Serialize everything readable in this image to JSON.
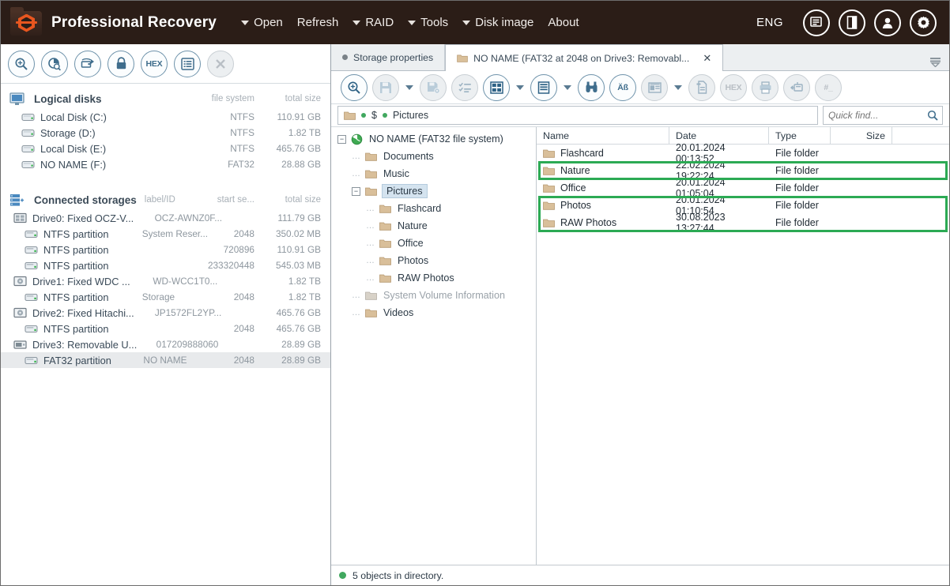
{
  "titlebar": {
    "app_title": "Professional Recovery",
    "logo_icon": "folder-hex-logo-icon",
    "menu": [
      {
        "label": "Open",
        "has_caret": true,
        "name": "menu-open"
      },
      {
        "label": "Refresh",
        "has_caret": false,
        "name": "menu-refresh"
      },
      {
        "label": "RAID",
        "has_caret": true,
        "name": "menu-raid"
      },
      {
        "label": "Tools",
        "has_caret": true,
        "name": "menu-tools"
      },
      {
        "label": "Disk image",
        "has_caret": true,
        "name": "menu-disk-image"
      },
      {
        "label": "About",
        "has_caret": false,
        "name": "menu-about"
      }
    ],
    "language": "ENG",
    "buttons": [
      {
        "name": "messages-button",
        "icon": "window-list-icon"
      },
      {
        "name": "panel-toggle-button",
        "icon": "split-panel-icon"
      },
      {
        "name": "account-button",
        "icon": "user-icon"
      },
      {
        "name": "settings-button",
        "icon": "gear-icon"
      }
    ]
  },
  "left_pane": {
    "toolbar": [
      {
        "name": "open-storage-button",
        "icon": "magnifier-disk-icon",
        "disabled": false
      },
      {
        "name": "disk-scan-button",
        "icon": "pie-scan-icon",
        "disabled": false
      },
      {
        "name": "mount-button",
        "icon": "mount-drive-icon",
        "disabled": false
      },
      {
        "name": "unlock-button",
        "icon": "lock-icon",
        "disabled": false
      },
      {
        "name": "hex-view-button",
        "icon": "hex-icon",
        "label": "HEX",
        "disabled": false
      },
      {
        "name": "properties-button",
        "icon": "list-icon",
        "disabled": false
      },
      {
        "name": "close-storage-button",
        "icon": "close-icon",
        "disabled": true
      }
    ],
    "logical_disks": {
      "title": "Logical disks",
      "icon": "monitor-icon",
      "columns": [
        "file system",
        "total size"
      ],
      "rows": [
        {
          "name": "Local Disk (C:)",
          "fs": "NTFS",
          "size": "110.91 GB",
          "icon": "drive-icon"
        },
        {
          "name": "Storage (D:)",
          "fs": "NTFS",
          "size": "1.82 TB",
          "icon": "drive-icon"
        },
        {
          "name": "Local Disk (E:)",
          "fs": "NTFS",
          "size": "465.76 GB",
          "icon": "drive-icon"
        },
        {
          "name": "NO NAME (F:)",
          "fs": "FAT32",
          "size": "28.88 GB",
          "icon": "drive-icon"
        }
      ]
    },
    "connected_storages": {
      "title": "Connected storages",
      "icon": "storages-icon",
      "columns": [
        "label/ID",
        "start se...",
        "total size"
      ],
      "rows": [
        {
          "name": "Drive0: Fixed OCZ-V...",
          "label": "OCZ-AWNZ0F...",
          "start": "",
          "size": "111.79 GB",
          "level": 0,
          "icon": "ssd-icon",
          "selected": false
        },
        {
          "name": "NTFS partition",
          "label": "System Reser...",
          "start": "2048",
          "size": "350.02 MB",
          "level": 1,
          "icon": "partition-icon",
          "selected": false
        },
        {
          "name": "NTFS partition",
          "label": "",
          "start": "720896",
          "size": "110.91 GB",
          "level": 1,
          "icon": "partition-icon",
          "selected": false
        },
        {
          "name": "NTFS partition",
          "label": "",
          "start": "233320448",
          "size": "545.03 MB",
          "level": 1,
          "icon": "partition-icon",
          "selected": false
        },
        {
          "name": "Drive1: Fixed WDC ...",
          "label": "WD-WCC1T0...",
          "start": "",
          "size": "1.82 TB",
          "level": 0,
          "icon": "hdd-icon",
          "selected": false
        },
        {
          "name": "NTFS partition",
          "label": "Storage",
          "start": "2048",
          "size": "1.82 TB",
          "level": 1,
          "icon": "partition-icon",
          "selected": false
        },
        {
          "name": "Drive2: Fixed Hitachi...",
          "label": "JP1572FL2YP...",
          "start": "",
          "size": "465.76 GB",
          "level": 0,
          "icon": "hdd-icon",
          "selected": false
        },
        {
          "name": "NTFS partition",
          "label": "",
          "start": "2048",
          "size": "465.76 GB",
          "level": 1,
          "icon": "partition-icon",
          "selected": false
        },
        {
          "name": "Drive3: Removable U...",
          "label": "017209888060",
          "start": "",
          "size": "28.89 GB",
          "level": 0,
          "icon": "usb-icon",
          "selected": false
        },
        {
          "name": "FAT32 partition",
          "label": "NO NAME",
          "start": "2048",
          "size": "28.89 GB",
          "level": 1,
          "icon": "partition-icon",
          "selected": true
        }
      ]
    }
  },
  "right_pane": {
    "tabs": [
      {
        "label": "Storage properties",
        "active": false,
        "icon": "dot-icon",
        "closable": false,
        "name": "tab-storage-properties"
      },
      {
        "label": "NO NAME (FAT32 at 2048 on Drive3: Removabl...",
        "active": true,
        "icon": "folder-icon",
        "closable": true,
        "close_glyph": "✕",
        "name": "tab-no-name-fat32"
      }
    ],
    "tabstrip_menu_icon": "tab-list-dropdown-icon",
    "toolbar": [
      {
        "name": "search-button",
        "icon": "magnifier-disk-icon",
        "dropdown": false,
        "disabled": false
      },
      {
        "name": "save-button",
        "icon": "save-icon",
        "dropdown": true,
        "disabled": true
      },
      {
        "name": "save-options-button",
        "icon": "save-settings-icon",
        "dropdown": false,
        "disabled": true
      },
      {
        "name": "checklist-button",
        "icon": "checklist-icon",
        "dropdown": false,
        "disabled": true
      },
      {
        "name": "layout-button",
        "icon": "grid-layout-icon",
        "dropdown": true,
        "disabled": false
      },
      {
        "name": "view-mode-button",
        "icon": "list-view-icon",
        "dropdown": true,
        "disabled": false
      },
      {
        "name": "find-button",
        "icon": "binoculars-icon",
        "dropdown": false,
        "disabled": false
      },
      {
        "name": "encoding-button",
        "icon": "text-encoding-icon",
        "label": "Äß",
        "dropdown": false,
        "disabled": false
      },
      {
        "name": "preview-button",
        "icon": "preview-pane-icon",
        "dropdown": true,
        "disabled": true
      },
      {
        "name": "copy-file-button",
        "icon": "copy-file-icon",
        "dropdown": false,
        "disabled": true
      },
      {
        "name": "hex-view-button",
        "icon": "hex-icon",
        "label": "HEX",
        "dropdown": false,
        "disabled": true
      },
      {
        "name": "print-button",
        "icon": "print-icon",
        "dropdown": false,
        "disabled": true
      },
      {
        "name": "export-button",
        "icon": "export-icon",
        "dropdown": false,
        "disabled": true
      },
      {
        "name": "goto-offset-button",
        "icon": "hash-icon",
        "label": "#_",
        "dropdown": false,
        "disabled": true
      }
    ],
    "path": {
      "icon": "folder-icon",
      "segments": [
        "$",
        "Pictures"
      ]
    },
    "quick_find": {
      "placeholder": "Quick find...",
      "value": "",
      "icon": "search-icon"
    },
    "tree": [
      {
        "label": "NO NAME (FAT32 file system)",
        "level": 0,
        "toggle": "minus",
        "icon": "volume-icon",
        "selected": false,
        "dim": false
      },
      {
        "label": "Documents",
        "level": 1,
        "toggle": "none",
        "icon": "folder-icon",
        "selected": false,
        "dim": false
      },
      {
        "label": "Music",
        "level": 1,
        "toggle": "none",
        "icon": "folder-icon",
        "selected": false,
        "dim": false
      },
      {
        "label": "Pictures",
        "level": 1,
        "toggle": "minus",
        "icon": "folder-icon",
        "selected": true,
        "dim": false
      },
      {
        "label": "Flashcard",
        "level": 2,
        "toggle": "none",
        "icon": "folder-icon",
        "selected": false,
        "dim": false
      },
      {
        "label": "Nature",
        "level": 2,
        "toggle": "none",
        "icon": "folder-icon",
        "selected": false,
        "dim": false
      },
      {
        "label": "Office",
        "level": 2,
        "toggle": "none",
        "icon": "folder-icon",
        "selected": false,
        "dim": false
      },
      {
        "label": "Photos",
        "level": 2,
        "toggle": "none",
        "icon": "folder-icon",
        "selected": false,
        "dim": false
      },
      {
        "label": "RAW Photos",
        "level": 2,
        "toggle": "none",
        "icon": "folder-icon",
        "selected": false,
        "dim": false
      },
      {
        "label": "System Volume Information",
        "level": 1,
        "toggle": "none",
        "icon": "folder-icon",
        "selected": false,
        "dim": true
      },
      {
        "label": "Videos",
        "level": 1,
        "toggle": "none",
        "icon": "folder-icon",
        "selected": false,
        "dim": false
      }
    ],
    "file_list": {
      "columns": [
        "Name",
        "Date",
        "Type",
        "Size"
      ],
      "rows": [
        {
          "name": "Flashcard",
          "date": "20.01.2024 00:13:52",
          "type": "File folder",
          "size": "",
          "icon": "folder-icon",
          "highlighted": false
        },
        {
          "name": "Nature",
          "date": "22.02.2024 19:22:24",
          "type": "File folder",
          "size": "",
          "icon": "folder-icon",
          "highlighted": true
        },
        {
          "name": "Office",
          "date": "20.01.2024 01:05:04",
          "type": "File folder",
          "size": "",
          "icon": "folder-icon",
          "highlighted": false
        },
        {
          "name": "Photos",
          "date": "20.01.2024 01:10:54",
          "type": "File folder",
          "size": "",
          "icon": "folder-icon",
          "highlighted": true
        },
        {
          "name": "RAW Photos",
          "date": "30.08.2023 13:27:44",
          "type": "File folder",
          "size": "",
          "icon": "folder-icon",
          "highlighted": true
        }
      ],
      "highlight_color": "#2caa54"
    },
    "statusbar": {
      "icon": "status-dot-icon",
      "text": "5 objects in directory."
    }
  },
  "colors": {
    "titlebar_bg": "#2b1d17",
    "accent_orange": "#e8561f",
    "icon_blue": "#3f6d8c",
    "highlight_green": "#2caa54",
    "selection_gray": "#e8eaec"
  }
}
